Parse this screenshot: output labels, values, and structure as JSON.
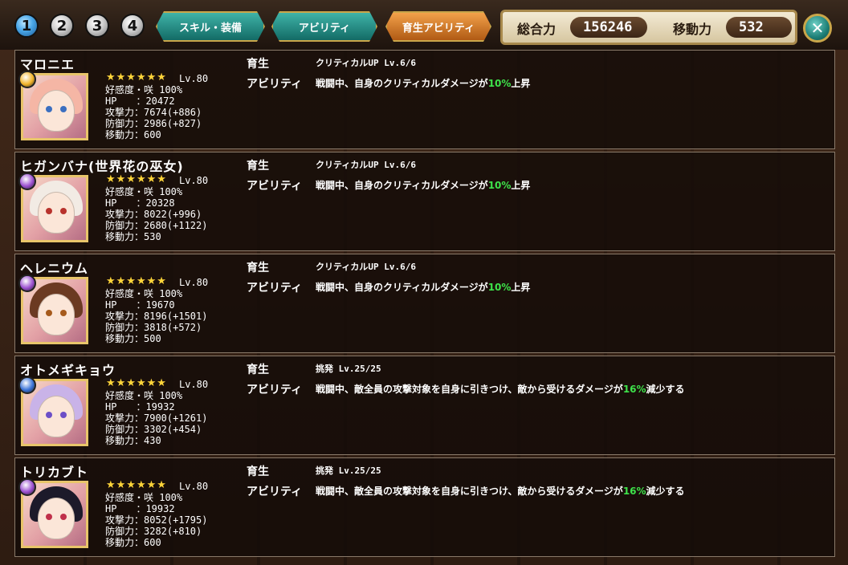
{
  "header": {
    "party_numbers": [
      "1",
      "2",
      "3",
      "4"
    ],
    "active_party": "1",
    "tabs": [
      {
        "label": "スキル・装備",
        "style": "teal"
      },
      {
        "label": "アビリティ",
        "style": "teal"
      },
      {
        "label": "育生アビリティ",
        "style": "orange"
      }
    ],
    "stats": {
      "total_power_label": "総合力",
      "total_power_value": "156246",
      "move_power_label": "移動力",
      "move_power_value": "532"
    },
    "close_symbol": "✕"
  },
  "labels": {
    "growth": "育生",
    "ability": "アビリティ",
    "affinity": "好感度・咲 100%",
    "hp": "HP",
    "attack": "攻撃力",
    "defense": "防御力",
    "move": "移動力"
  },
  "characters": [
    {
      "name": "マロニエ",
      "stars": "★★★★★★",
      "level": "Lv.80",
      "affinity": "好感度・咲 100%",
      "hp": "HP　　：20472",
      "attack": "攻撃力：7674(+886)",
      "defense": "防御力：2986(+827)",
      "move": "移動力：600",
      "skill": "クリティカルUP Lv.6/6",
      "desc_pre": "戦闘中、自身のクリティカルダメージが",
      "desc_hl": "10%",
      "desc_post": "上昇",
      "element_color": "#f2b42a",
      "hair_color": "#f5b6a5",
      "eye_color": "#3b6fc0"
    },
    {
      "name": "ヒガンバナ(世界花の巫女)",
      "stars": "★★★★★★",
      "level": "Lv.80",
      "affinity": "好感度・咲 100%",
      "hp": "HP　　：20328",
      "attack": "攻撃力：8022(+996)",
      "defense": "防御力：2680(+1122)",
      "move": "移動力：530",
      "skill": "クリティカルUP Lv.6/6",
      "desc_pre": "戦闘中、自身のクリティカルダメージが",
      "desc_hl": "10%",
      "desc_post": "上昇",
      "element_color": "#9b4fd0",
      "hair_color": "#f2ebe4",
      "eye_color": "#b8322c"
    },
    {
      "name": "ヘレニウム",
      "stars": "★★★★★★",
      "level": "Lv.80",
      "affinity": "好感度・咲 100%",
      "hp": "HP　　：19670",
      "attack": "攻撃力：8196(+1501)",
      "defense": "防御力：3818(+572)",
      "move": "移動力：500",
      "skill": "クリティカルUP Lv.6/6",
      "desc_pre": "戦闘中、自身のクリティカルダメージが",
      "desc_hl": "10%",
      "desc_post": "上昇",
      "element_color": "#9b4fd0",
      "hair_color": "#6b3a22",
      "eye_color": "#a65a1c"
    },
    {
      "name": "オトメギキョウ",
      "stars": "★★★★★★",
      "level": "Lv.80",
      "affinity": "好感度・咲 100%",
      "hp": "HP　　：19932",
      "attack": "攻撃力：7900(+1261)",
      "defense": "防御力：3302(+454)",
      "move": "移動力：430",
      "skill": "挑発 Lv.25/25",
      "desc_pre": "戦闘中、敵全員の攻撃対象を自身に引きつけ、敵から受けるダメージが",
      "desc_hl": "16%",
      "desc_post": "減少する",
      "element_color": "#3a73d8",
      "hair_color": "#c9b3e8",
      "eye_color": "#6c4fc7"
    },
    {
      "name": "トリカブト",
      "stars": "★★★★★★",
      "level": "Lv.80",
      "affinity": "好感度・咲 100%",
      "hp": "HP　　：19932",
      "attack": "攻撃力：8052(+1795)",
      "defense": "防御力：3282(+810)",
      "move": "移動力：600",
      "skill": "挑発 Lv.25/25",
      "desc_pre": "戦闘中、敵全員の攻撃対象を自身に引きつけ、敵から受けるダメージが",
      "desc_hl": "16%",
      "desc_post": "減少する",
      "element_color": "#9b4fd0",
      "hair_color": "#1c1a2a",
      "eye_color": "#c0304a"
    }
  ]
}
